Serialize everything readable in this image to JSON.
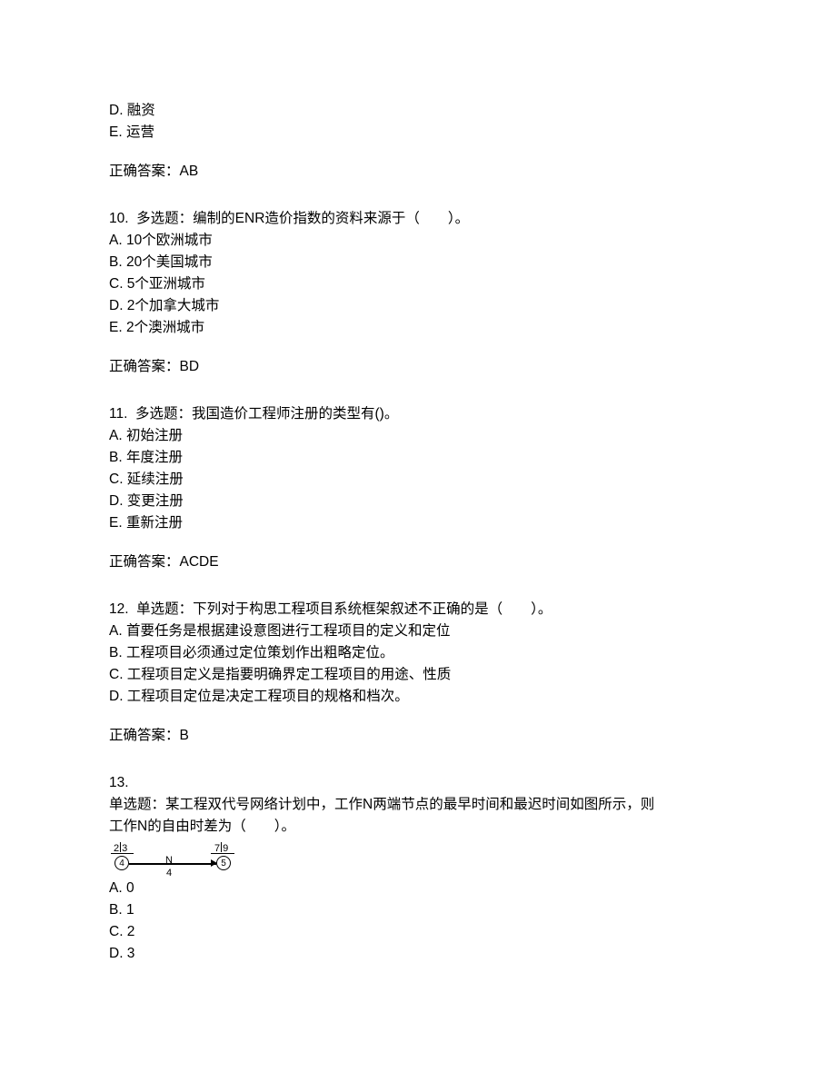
{
  "q9": {
    "optD": "D. 融资",
    "optE": "E. 运营",
    "answer": "正确答案：AB"
  },
  "q10": {
    "title": "10.  多选题：编制的ENR造价指数的资料来源于（　　）。",
    "optA": "A. 10个欧洲城市",
    "optB": "B. 20个美国城市",
    "optC": "C. 5个亚洲城市",
    "optD": "D. 2个加拿大城市",
    "optE": "E. 2个澳洲城市",
    "answer": "正确答案：BD"
  },
  "q11": {
    "title": "11.  多选题：我国造价工程师注册的类型有()。",
    "optA": "A. 初始注册",
    "optB": "B. 年度注册",
    "optC": "C. 延续注册",
    "optD": "D. 变更注册",
    "optE": "E. 重新注册",
    "answer": "正确答案：ACDE"
  },
  "q12": {
    "title": "12.  单选题：下列对于构思工程项目系统框架叙述不正确的是（　　）。",
    "optA": "A. 首要任务是根据建设意图进行工程项目的定义和定位",
    "optB": "B. 工程项目必须通过定位策划作出粗略定位。",
    "optC": "C. 工程项目定义是指要明确界定工程项目的用途、性质",
    "optD": "D. 工程项目定位是决定工程项目的规格和档次。",
    "answer": "正确答案：B"
  },
  "q13": {
    "num": "13.",
    "title1": "单选题：某工程双代号网络计划中，工作N两端节点的最早时间和最迟时间如图所示，则",
    "title2": "工作N的自由时差为（　　）。",
    "diagram": {
      "nodeA_id": "4",
      "nodeA_es": "2",
      "nodeA_ls": "3",
      "nodeB_id": "5",
      "nodeB_es": "7",
      "nodeB_ls": "9",
      "act_name": "N",
      "act_dur": "4"
    },
    "optA": "A. 0",
    "optB": "B. 1",
    "optC": "C. 2",
    "optD": "D. 3"
  }
}
